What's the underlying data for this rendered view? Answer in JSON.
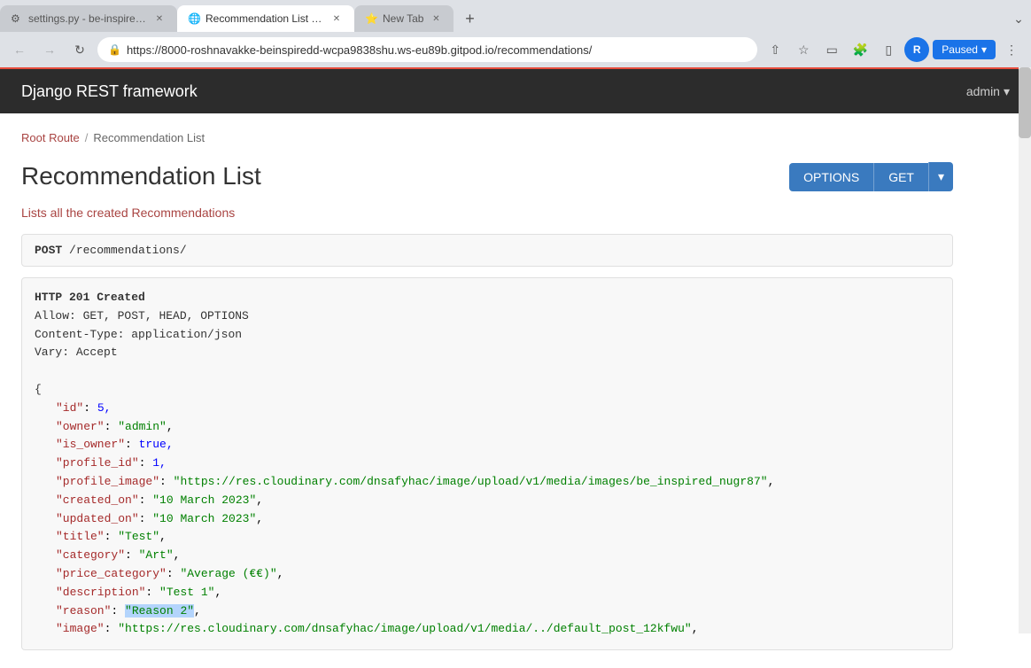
{
  "browser": {
    "tabs": [
      {
        "id": "tab1",
        "label": "settings.py - be-inspired-drf-api-...",
        "favicon": "⚙",
        "active": false
      },
      {
        "id": "tab2",
        "label": "Recommendation List – Django R...",
        "favicon": "🌐",
        "active": true
      },
      {
        "id": "tab3",
        "label": "New Tab",
        "favicon": "⭐",
        "active": false
      }
    ],
    "address": "https://8000-roshnavakke-beinspiredd-wcpa9838shu.ws-eu89b.gitpod.io/recommendations/",
    "profile_initial": "R",
    "paused_label": "Paused"
  },
  "navbar": {
    "brand": "Django REST framework",
    "user": "admin",
    "user_caret": "▾"
  },
  "breadcrumb": {
    "root_label": "Root Route",
    "separator": "/",
    "current": "Recommendation List"
  },
  "page": {
    "title": "Recommendation List",
    "description": "Lists all the created Recommendations",
    "options_btn": "OPTIONS",
    "get_btn": "GET",
    "get_caret": "▾",
    "method_line": "POST /recommendations/",
    "response": {
      "status_line": "HTTP 201 Created",
      "allow_label": "Allow:",
      "allow_value": "GET, POST, HEAD, OPTIONS",
      "content_type_label": "Content-Type:",
      "content_type_value": "application/json",
      "vary_label": "Vary:",
      "vary_value": "Accept"
    },
    "json": {
      "id_key": "\"id\"",
      "id_val": "5,",
      "owner_key": "\"owner\"",
      "owner_val": "\"admin\",",
      "is_owner_key": "\"is_owner\"",
      "is_owner_val": "true,",
      "profile_id_key": "\"profile_id\"",
      "profile_id_val": "1,",
      "profile_image_key": "\"profile_image\"",
      "profile_image_val": "\"https://res.cloudinary.com/dnsafyhac/image/upload/v1/media/images/be_inspired_nugr87\",",
      "created_on_key": "\"created_on\"",
      "created_on_val": "\"10 March 2023\",",
      "updated_on_key": "\"updated_on\"",
      "updated_on_val": "\"10 March 2023\",",
      "title_key": "\"title\"",
      "title_val": "\"Test\",",
      "category_key": "\"category\"",
      "category_val": "\"Art\",",
      "price_category_key": "\"price_category\"",
      "price_category_val": "\"Average (€€)\",",
      "description_key": "\"description\"",
      "description_val": "\"Test 1\",",
      "reason_key": "\"reason\"",
      "reason_val": "\"Reason 2\",",
      "image_key": "\"image\"",
      "image_val": "\"https://res.cloudinary.com/dnsafyhac/image/upload/v1/media/../default_post_12kfwu\","
    }
  }
}
